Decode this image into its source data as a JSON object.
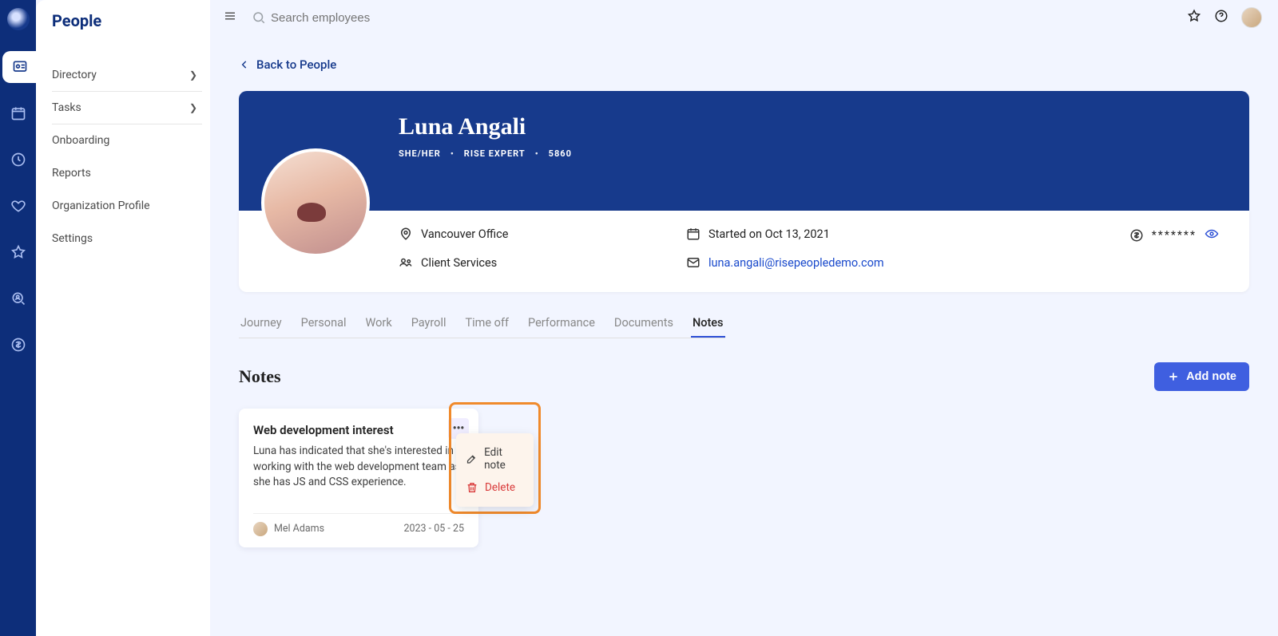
{
  "app": {
    "section_title": "People"
  },
  "sidebar": {
    "items": [
      {
        "label": "Directory",
        "has_chevron": true
      },
      {
        "label": "Tasks",
        "has_chevron": true
      },
      {
        "label": "Onboarding"
      },
      {
        "label": "Reports"
      },
      {
        "label": "Organization Profile"
      },
      {
        "label": "Settings"
      }
    ]
  },
  "topbar": {
    "search_placeholder": "Search employees"
  },
  "backlink": {
    "label": "Back to People"
  },
  "profile": {
    "name": "Luna Angali",
    "pronouns": "SHE/HER",
    "role": "RISE EXPERT",
    "id": "5860",
    "location": "Vancouver Office",
    "department": "Client Services",
    "start_date": "Started on Oct 13, 2021",
    "email": "luna.angali@risepeopledemo.com",
    "salary_masked": "*******"
  },
  "tabs": [
    {
      "label": "Journey"
    },
    {
      "label": "Personal"
    },
    {
      "label": "Work"
    },
    {
      "label": "Payroll"
    },
    {
      "label": "Time off"
    },
    {
      "label": "Performance"
    },
    {
      "label": "Documents"
    },
    {
      "label": "Notes",
      "active": true
    }
  ],
  "notes": {
    "heading": "Notes",
    "add_button": "Add note",
    "cards": [
      {
        "title": "Web development interest",
        "body": "Luna has indicated that she's interested in working with the web development team as she has JS and CSS experience.",
        "author": "Mel Adams",
        "date": "2023 - 05 - 25"
      }
    ],
    "menu": {
      "edit": "Edit note",
      "delete": "Delete"
    }
  }
}
